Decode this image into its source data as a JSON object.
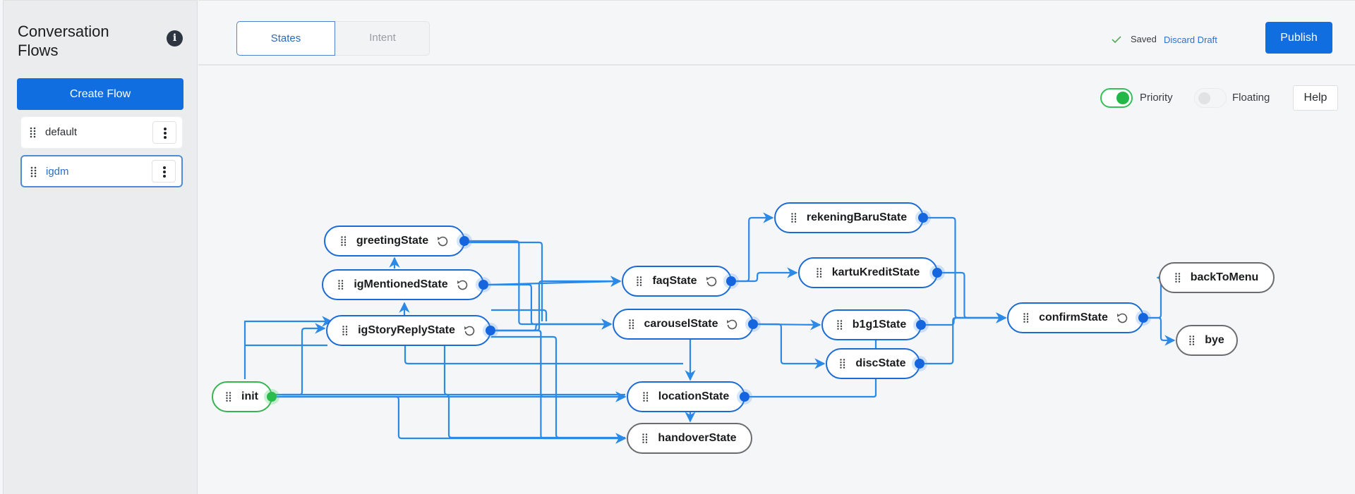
{
  "sidebar": {
    "title": "Conversation Flows",
    "info_icon": "info-icon",
    "create_button": "Create Flow",
    "flows": [
      {
        "label": "default",
        "active": false
      },
      {
        "label": "igdm",
        "active": true
      }
    ]
  },
  "topbar": {
    "tabs": [
      {
        "label": "States",
        "selected": true
      },
      {
        "label": "Intent",
        "selected": false
      }
    ],
    "status": "Saved",
    "discard_label": "Discard Draft",
    "publish_label": "Publish"
  },
  "canvas_controls": {
    "priority_label": "Priority",
    "priority_on": true,
    "floating_label": "Floating",
    "floating_on": false,
    "help_label": "Help"
  },
  "colors": {
    "accent": "#116ee0",
    "edge": "#2b8ae8",
    "node_border": "#1b6bd6",
    "init_border": "#34b551",
    "terminal_border": "#6a6c70"
  },
  "graph": {
    "nodes": [
      {
        "id": "init",
        "label": "init",
        "kind": "init",
        "resettable": false
      },
      {
        "id": "greetingState",
        "label": "greetingState",
        "kind": "state",
        "resettable": true
      },
      {
        "id": "igMentionedState",
        "label": "igMentionedState",
        "kind": "state",
        "resettable": true
      },
      {
        "id": "igStoryReplyState",
        "label": "igStoryReplyState",
        "kind": "state",
        "resettable": true
      },
      {
        "id": "faqState",
        "label": "faqState",
        "kind": "state",
        "resettable": true
      },
      {
        "id": "carouselState",
        "label": "carouselState",
        "kind": "state",
        "resettable": true
      },
      {
        "id": "locationState",
        "label": "locationState",
        "kind": "state",
        "resettable": false
      },
      {
        "id": "handoverState",
        "label": "handoverState",
        "kind": "terminal",
        "resettable": false
      },
      {
        "id": "rekeningBaruState",
        "label": "rekeningBaruState",
        "kind": "state",
        "resettable": false
      },
      {
        "id": "kartuKreditState",
        "label": "kartuKreditState",
        "kind": "state",
        "resettable": false
      },
      {
        "id": "b1g1State",
        "label": "b1g1State",
        "kind": "state",
        "resettable": false
      },
      {
        "id": "discState",
        "label": "discState",
        "kind": "state",
        "resettable": false
      },
      {
        "id": "confirmState",
        "label": "confirmState",
        "kind": "state",
        "resettable": true
      },
      {
        "id": "backToMenu",
        "label": "backToMenu",
        "kind": "terminal",
        "resettable": false
      },
      {
        "id": "bye",
        "label": "bye",
        "kind": "terminal",
        "resettable": false
      }
    ],
    "edges": [
      [
        "init",
        "igStoryReplyState"
      ],
      [
        "init",
        "igMentionedState"
      ],
      [
        "init",
        "locationState"
      ],
      [
        "init",
        "handoverState"
      ],
      [
        "igStoryReplyState",
        "igMentionedState"
      ],
      [
        "igMentionedState",
        "greetingState"
      ],
      [
        "greetingState",
        "carouselState"
      ],
      [
        "igMentionedState",
        "faqState"
      ],
      [
        "igMentionedState",
        "carouselState"
      ],
      [
        "igStoryReplyState",
        "faqState"
      ],
      [
        "igStoryReplyState",
        "carouselState"
      ],
      [
        "igStoryReplyState",
        "locationState"
      ],
      [
        "igStoryReplyState",
        "handoverState"
      ],
      [
        "faqState",
        "rekeningBaruState"
      ],
      [
        "faqState",
        "kartuKreditState"
      ],
      [
        "carouselState",
        "b1g1State"
      ],
      [
        "carouselState",
        "discState"
      ],
      [
        "carouselState",
        "locationState"
      ],
      [
        "locationState",
        "handoverState"
      ],
      [
        "locationState",
        "b1g1State"
      ],
      [
        "rekeningBaruState",
        "confirmState"
      ],
      [
        "kartuKreditState",
        "confirmState"
      ],
      [
        "b1g1State",
        "confirmState"
      ],
      [
        "discState",
        "confirmState"
      ],
      [
        "confirmState",
        "backToMenu"
      ],
      [
        "confirmState",
        "bye"
      ]
    ]
  }
}
